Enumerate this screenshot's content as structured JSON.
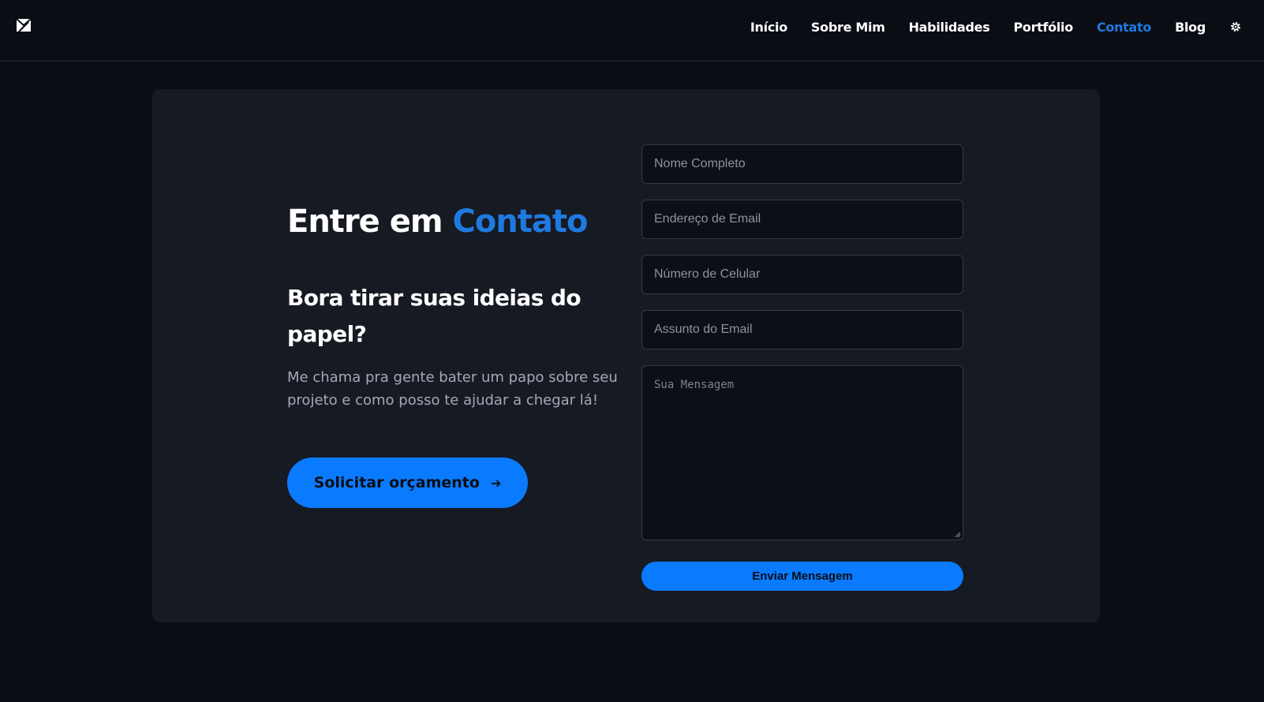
{
  "nav": {
    "logo_icon": "logo-icon",
    "links": [
      {
        "label": "Início",
        "active": false
      },
      {
        "label": "Sobre Mim",
        "active": false
      },
      {
        "label": "Habilidades",
        "active": false
      },
      {
        "label": "Portfólio",
        "active": false
      },
      {
        "label": "Contato",
        "active": true
      },
      {
        "label": "Blog",
        "active": false
      }
    ],
    "settings_icon": "gear-icon"
  },
  "contact": {
    "heading_prefix": "Entre em",
    "heading_accent": "Contato",
    "subheading": "Bora tirar suas ideias do papel?",
    "description": "Me chama pra gente bater um papo sobre seu projeto e como posso te ajudar a chegar lá!",
    "cta_label": "Solicitar orçamento",
    "cta_icon": "arrow-right-icon"
  },
  "form": {
    "name_placeholder": "Nome Completo",
    "email_placeholder": "Endereço de Email",
    "phone_placeholder": "Número de Celular",
    "subject_placeholder": "Assunto do Email",
    "message_placeholder": "Sua Mensagem",
    "submit_label": "Enviar Mensagem"
  },
  "colors": {
    "background": "#0a0d14",
    "card": "#161a23",
    "accent": "#0a7bff",
    "nav_active": "#1f7ae0"
  }
}
